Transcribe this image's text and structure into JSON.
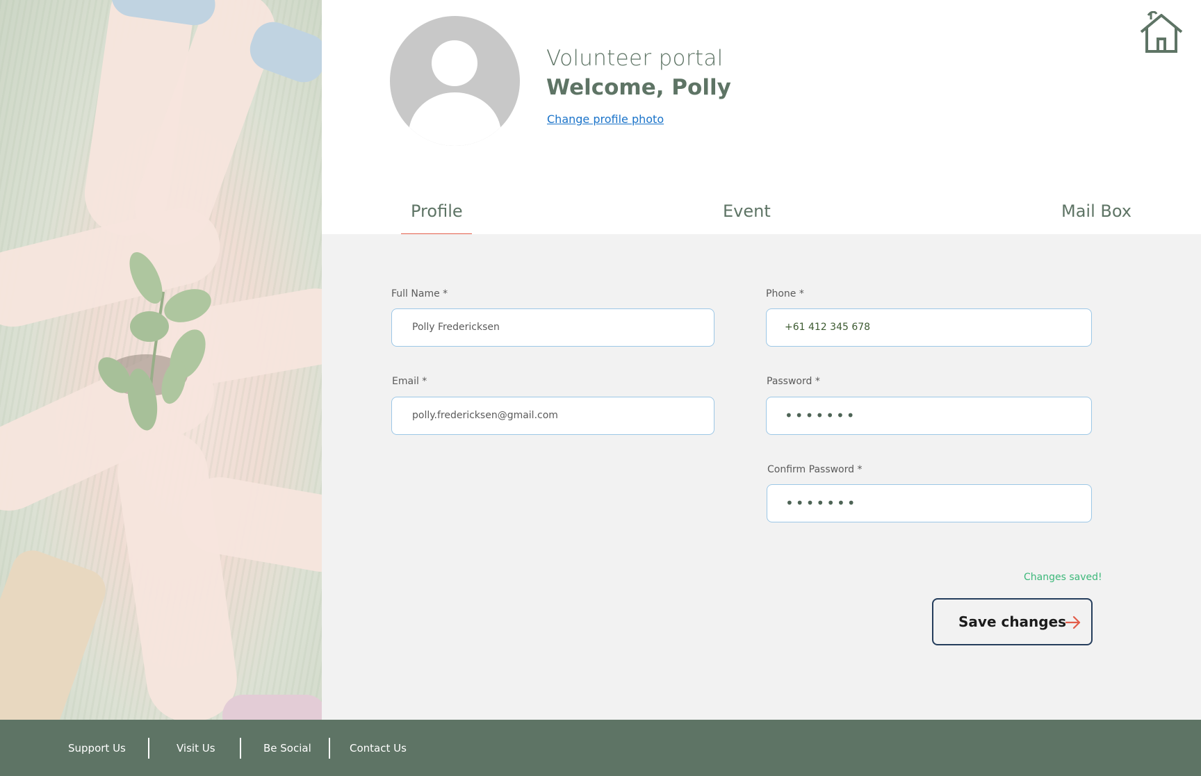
{
  "header": {
    "portal_title": "Volunteer portal",
    "welcome": "Welcome, Polly",
    "change_photo_link": "Change profile photo",
    "home_icon": "home-icon"
  },
  "tabs": [
    {
      "label": "Profile",
      "active": true
    },
    {
      "label": "Event",
      "active": false
    },
    {
      "label": "Mail Box",
      "active": false
    }
  ],
  "form": {
    "full_name": {
      "label": "Full Name *",
      "value": "Polly Fredericksen"
    },
    "phone": {
      "label": "Phone *",
      "value": "+61 412 345 678"
    },
    "email": {
      "label": "Email *",
      "value": "polly.fredericksen@gmail.com"
    },
    "password": {
      "label": "Password *",
      "value": "•••••••"
    },
    "confirm_password": {
      "label": "Confirm Password *",
      "value": "•••••••"
    },
    "status": "Changes saved!",
    "save_button": "Save changes"
  },
  "footer": {
    "links": [
      "Support Us",
      "Visit Us",
      "Be Social",
      "Contact Us"
    ]
  },
  "colors": {
    "brand_green": "#5e7465",
    "accent_red": "#e35d4a",
    "link_blue": "#1a73c9",
    "success_green": "#3db87a",
    "input_border": "#9cc7e6",
    "button_border": "#243d5c"
  }
}
